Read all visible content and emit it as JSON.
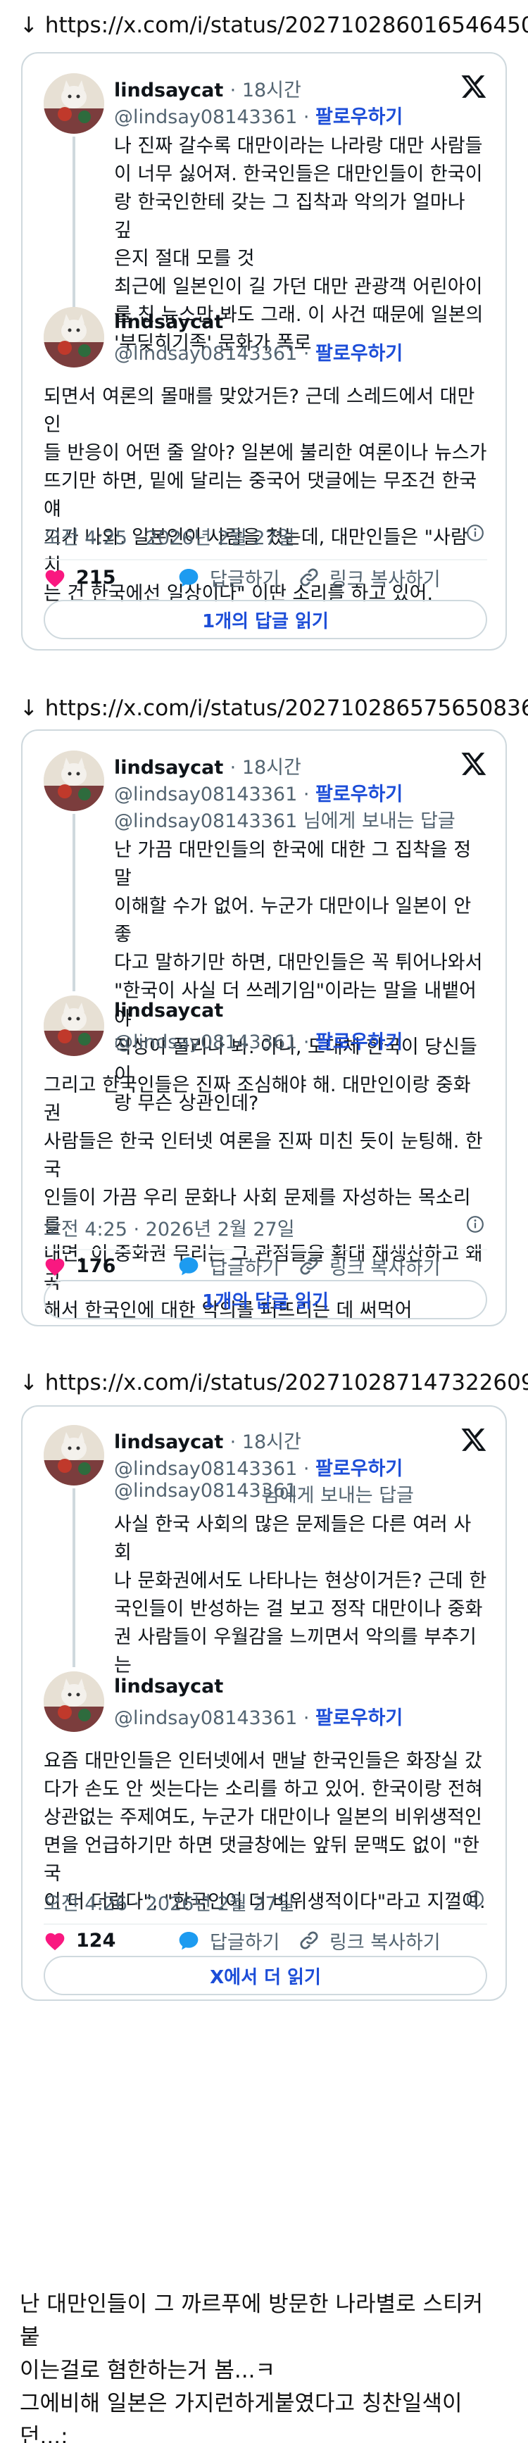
{
  "follow_label": "팔로우하기",
  "reply_to_suffix": "님에게 보내는 답글",
  "actions": {
    "reply": "답글하기",
    "copy_link": "링크 복사하기"
  },
  "posts": [
    {
      "url": "↓ https://x.com/i/status/2027102860165464501",
      "quoted_tweets": [
        {
          "name": "lindsaycat",
          "time": "· 18시간",
          "handle": "@lindsay08143361",
          "text": "나 진짜 갈수록 대만이라는 나라랑 대만 사람들\n이 너무 싫어져. 한국인들은 대만인들이 한국이\n랑 한국인한테 갖는 그 집착과 악의가 얼마나 깊\n은지 절대 모를 것\n최근에 일본인이 길 가던 대만 관광객 어린아이\n를 친 뉴스만 봐도 그래. 이 사건 때문에 일본의\n'부딪히기족' 문화가 폭로"
        }
      ],
      "main": {
        "name": "lindsaycat",
        "handle": "@lindsay08143361",
        "text": "되면서 여론의 몰매를 맞았거든? 근데 스레드에서 대만인\n들 반응이 어떤 줄 알아? 일본에 불리한 여론이나 뉴스가\n뜨기만 하면, 밑에 달리는 중국어 댓글에는 무조건 한국 얘\n기가 나와. 일본인이 사람을 쳤는데, 대만인들은 \"사람 치\n는 건 한국에선 일상이다\" 이딴 소리를 하고 있어.",
        "timestamp": "오전 4:25 · 2026년 2월 27일",
        "likes": "215",
        "button": "1개의 답글 읽기"
      }
    },
    {
      "url": "↓ https://x.com/i/status/2027102865756508368",
      "quoted_tweets": [
        {
          "name": "lindsaycat",
          "time": "· 18시간",
          "handle": "@lindsay08143361",
          "reply_to": "@lindsay08143361",
          "text": "난 가끔 대만인들의 한국에 대한 그 집착을 정말\n이해할 수가 없어. 누군가 대만이나 일본이 안 좋\n다고 말하기만 하면, 대만인들은 꼭 튀어나와서\n\"한국이 사실 더 쓰레기임\"이라는 말을 내뱉어야\n직성이 풀리나 봐. 아니, 도대체 한국이 당신들이\n랑 무슨 상관인데?"
        }
      ],
      "main": {
        "name": "lindsaycat",
        "handle": "@lindsay08143361",
        "text": "그리고 한국인들은 진짜 조심해야 해. 대만인이랑 중화권\n사람들은 한국 인터넷 여론을 진짜 미친 듯이 눈팅해. 한국\n인들이 가끔 우리 문화나 사회 문제를 자성하는 목소리를\n내면, 이 중화권 무리는 그 관점들을 확대 재생산하고 왜곡\n해서 한국인에 대한 악의를 퍼뜨리는 데 써먹어",
        "timestamp": "오전 4:25 · 2026년 2월 27일",
        "likes": "176",
        "button": "1개의 답글 읽기"
      }
    },
    {
      "url": "↓ https://x.com/i/status/2027102871473226090",
      "quoted_tweets": [
        {
          "name": "lindsaycat",
          "time": "· 18시간",
          "handle": "@lindsay08143361",
          "extra_handle": "@lindsay08143361",
          "reply_to": "@lindsay08143361",
          "text": "사실 한국 사회의 많은 문제들은 다른 여러 사회\n나 문화권에서도 나타나는 현상이거든? 근데 한\n국인들이 반성하는 걸 보고 정작 대만이나 중화\n권 사람들이 우월감을 느끼면서 악의를 부추기는\n거야. 한국 전민성형설, 한국 학폭국 소리들이 다\n이런 식으로 나온 거... 지들은 뭐 깨끗한 줄 아냐"
        }
      ],
      "main": {
        "name": "lindsaycat",
        "handle": "@lindsay08143361",
        "text": "요즘 대만인들은 인터넷에서 맨날 한국인들은 화장실 갔\n다가 손도 안 씻는다는 소리를 하고 있어. 한국이랑 전혀\n상관없는 주제여도, 누군가 대만이나 일본의 비위생적인\n면을 언급하기만 하면 댓글창에는 앞뒤 문맥도 없이 \"한국\n이 더 더럽다\", \"한국인이 더 비위생적이다\"라고 지껄여.",
        "timestamp": "오전 4:26 · 2026년 2월 27일",
        "likes": "124",
        "button": "X에서 더 읽기"
      }
    }
  ],
  "caption": "난 대만인들이 그 까르푸에 방문한 나라별로 스티커 붙\n이는걸로 혐한하는거 봄...ㅋ\n그에비해 일본은 가지런하게붙였다고 칭찬일색이던...;"
}
